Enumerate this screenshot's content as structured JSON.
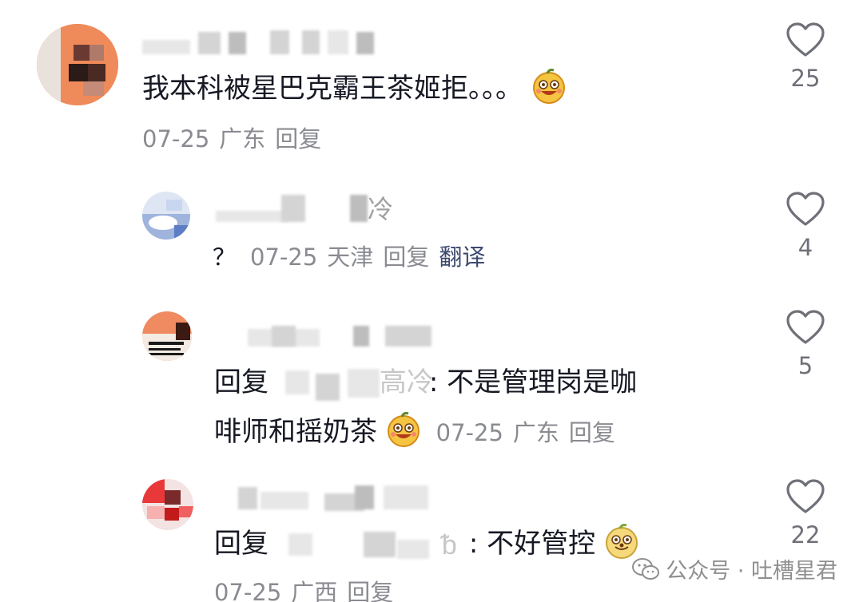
{
  "comments": [
    {
      "name_fragment": "",
      "content": "我本科被星巴克霸王茶姬拒。。。",
      "date": "07-25",
      "location": "广东",
      "reply_label": "回复",
      "likes": "25"
    },
    {
      "name_fragment": "冷",
      "prefix": "？",
      "date": "07-25",
      "location": "天津",
      "reply_label": "回复",
      "translate_label": "翻译",
      "likes": "4"
    },
    {
      "reply_prefix": "回复",
      "mention_fragment": "高冷",
      "content_line1": ": 不是管理岗是咖",
      "content_line2": "啡师和摇奶茶",
      "date": "07-25",
      "location": "广东",
      "reply_label": "回复",
      "likes": "5"
    },
    {
      "reply_prefix": "回复",
      "mention_fragment": "ᵬ",
      "content": ": 不好管控",
      "date": "07-25",
      "location": "广西",
      "reply_label": "回复",
      "likes": "22"
    }
  ],
  "watermark": {
    "text": "公众号 · 吐槽星君",
    "icon": "wechat-icon"
  },
  "colors": {
    "text": "#161823",
    "meta": "#8a8b91",
    "translate": "#3d4a70"
  }
}
